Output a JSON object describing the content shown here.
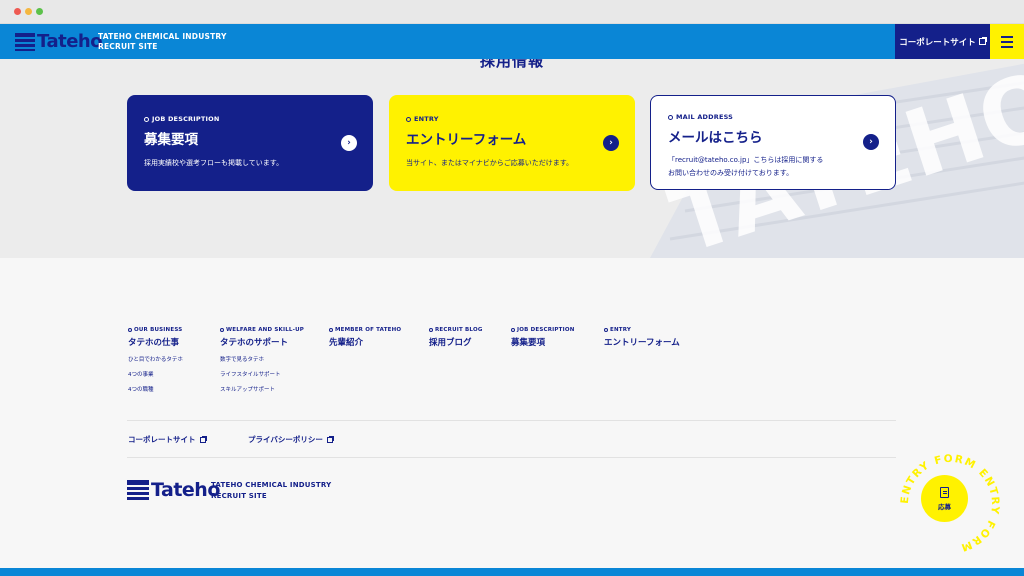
{
  "header": {
    "logo_text": "Tateho",
    "sub_line1": "TATEHO CHEMICAL INDUSTRY",
    "sub_line2": "RECRUIT SITE",
    "corporate_label": "コーポレートサイト",
    "menu_icon": "hamburger-icon"
  },
  "section": {
    "title": "採用情報",
    "watermark": "TATEHO"
  },
  "cards": [
    {
      "eyebrow": "JOB DESCRIPTION",
      "title": "募集要項",
      "desc": "採用実績校や選考フローも掲載しています。"
    },
    {
      "eyebrow": "ENTRY",
      "title": "エントリーフォーム",
      "desc": "当サイト、またはマイナビからご応募いただけます。"
    },
    {
      "eyebrow": "MAIL ADDRESS",
      "title": "メールはこちら",
      "desc_line1": "「recruit@tateho.co.jp」こちらは採用に関する",
      "desc_line2": "お問い合わせのみ受け付けております。"
    }
  ],
  "footer_nav": [
    {
      "eyebrow": "OUR BUSINESS",
      "title": "タテホの仕事",
      "items": [
        "ひと目でわかるタテホ",
        "4つの事業",
        "4つの職種"
      ]
    },
    {
      "eyebrow": "WELFARE AND SKILL-UP",
      "title": "タテホのサポート",
      "items": [
        "数字で見るタテホ",
        "ライフスタイルサポート",
        "スキルアップサポート"
      ]
    },
    {
      "eyebrow": "MEMBER OF TATEHO",
      "title": "先輩紹介",
      "items": []
    },
    {
      "eyebrow": "RECRUIT BLOG",
      "title": "採用ブログ",
      "items": []
    },
    {
      "eyebrow": "JOB DESCRIPTION",
      "title": "募集要項",
      "items": []
    },
    {
      "eyebrow": "ENTRY",
      "title": "エントリーフォーム",
      "items": []
    }
  ],
  "footer_links": {
    "corporate": "コーポレートサイト",
    "privacy": "プライバシーポリシー"
  },
  "footer_logo": {
    "text": "Tateho",
    "sub_line1": "TATEHO CHEMICAL INDUSTRY",
    "sub_line2": "RECRUIT SITE"
  },
  "entry_badge": {
    "ring_text": "ENTRY FORM  ENTRY FORM  ",
    "label": "応募"
  },
  "colors": {
    "navy": "#14208a",
    "blue": "#0a86d6",
    "yellow": "#fff200"
  }
}
